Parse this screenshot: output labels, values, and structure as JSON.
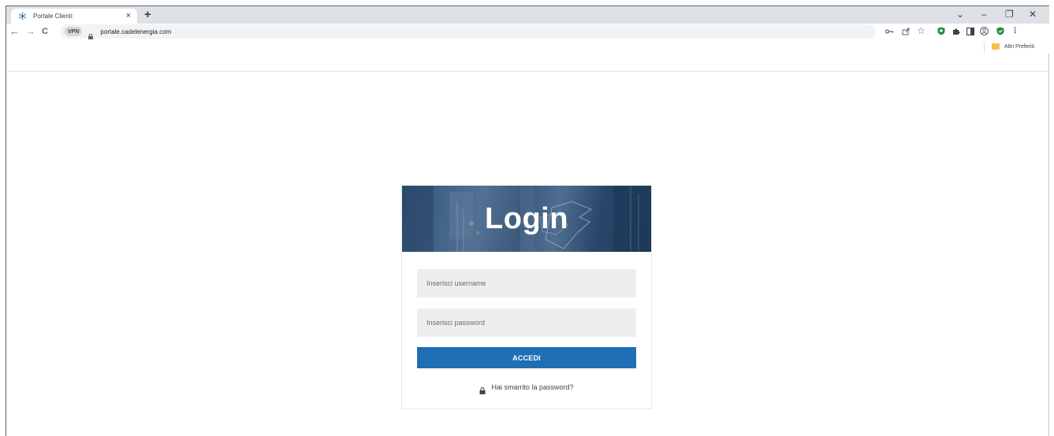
{
  "browser": {
    "tab_title": "Portale Clienti",
    "tab_close": "×",
    "new_tab": "+",
    "window_controls": {
      "dropdown": "⌄",
      "minimize": "–",
      "restore": "❐",
      "close": "✕"
    },
    "nav": {
      "back": "←",
      "forward": "→",
      "reload": "C"
    },
    "vpn_badge": "VPN",
    "url": "portale.cadelenergia.com",
    "bookmark_folder": "Altri Preferiti",
    "toolbar_icons": [
      "key-icon",
      "share-icon",
      "star-icon",
      "shield-extension-icon",
      "puzzle-extensions-icon",
      "side-panel-icon",
      "profile-icon",
      "adblock-shield-icon",
      "more-menu-icon"
    ]
  },
  "login": {
    "title": "Login",
    "username_placeholder": "Inserisci username",
    "password_placeholder": "Inserisci password",
    "submit_label": "ACCEDI",
    "forgot_label": "Hai smarrito la password?"
  },
  "colors": {
    "accent_button": "#1f6fb5",
    "field_bg": "#eeeeee",
    "hero_overlay": "#204269"
  }
}
